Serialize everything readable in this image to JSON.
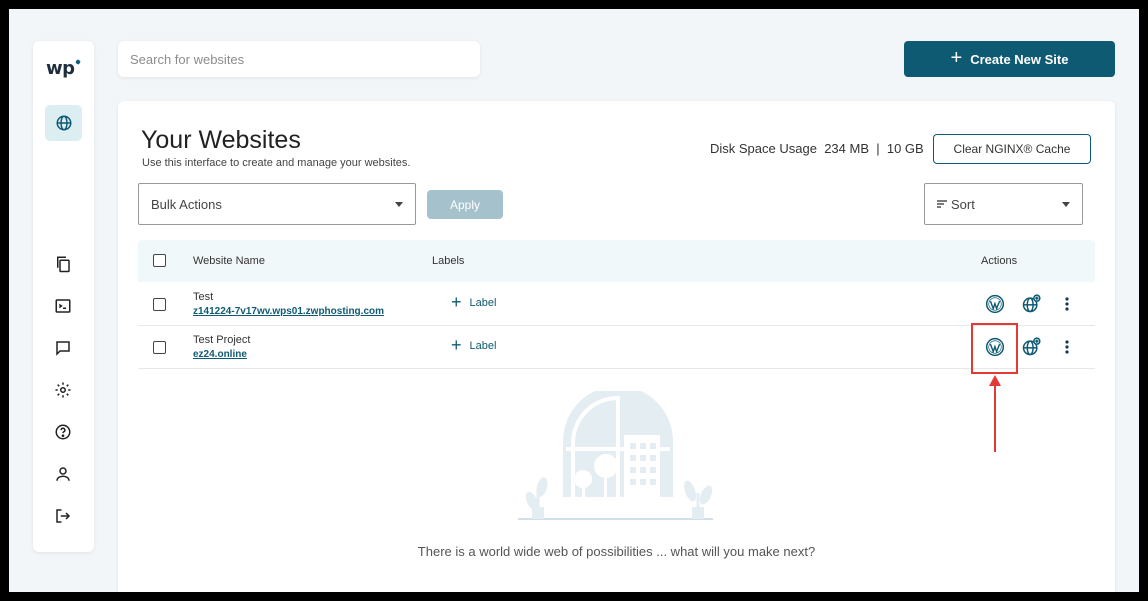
{
  "app": {
    "logo": "wp"
  },
  "search": {
    "placeholder": "Search for websites"
  },
  "header": {
    "create_label": "Create New Site"
  },
  "main": {
    "title": "Your Websites",
    "subtitle": "Use this interface to create and manage your websites.",
    "disk_label": "Disk Space Usage",
    "disk_used": "234 MB",
    "disk_sep": "|",
    "disk_total": "10 GB",
    "clear_cache_label": "Clear NGINX® Cache",
    "bulk_actions": "Bulk Actions",
    "apply_label": "Apply",
    "sort_label": "Sort"
  },
  "table": {
    "headers": {
      "name": "Website Name",
      "labels": "Labels",
      "actions": "Actions"
    },
    "rows": [
      {
        "name": "Test",
        "url": "z141224-7v17wv.wps01.zwphosting.com",
        "label": "Label"
      },
      {
        "name": "Test Project",
        "url": "ez24.online",
        "label": "Label"
      }
    ]
  },
  "empty": {
    "message": "There is a world wide web of possibilities ... what will you make next?"
  },
  "colors": {
    "accent": "#0f5a73",
    "highlight": "#e53935",
    "apply_disabled": "#a5c2cc"
  },
  "icons": {
    "sidebar": [
      "globe-icon",
      "copy-icon",
      "terminal-icon",
      "chat-icon",
      "gear-icon",
      "help-icon",
      "user-icon",
      "logout-icon"
    ],
    "row_actions": [
      "wordpress-icon",
      "globe-plus-icon",
      "more-vertical-icon"
    ]
  }
}
